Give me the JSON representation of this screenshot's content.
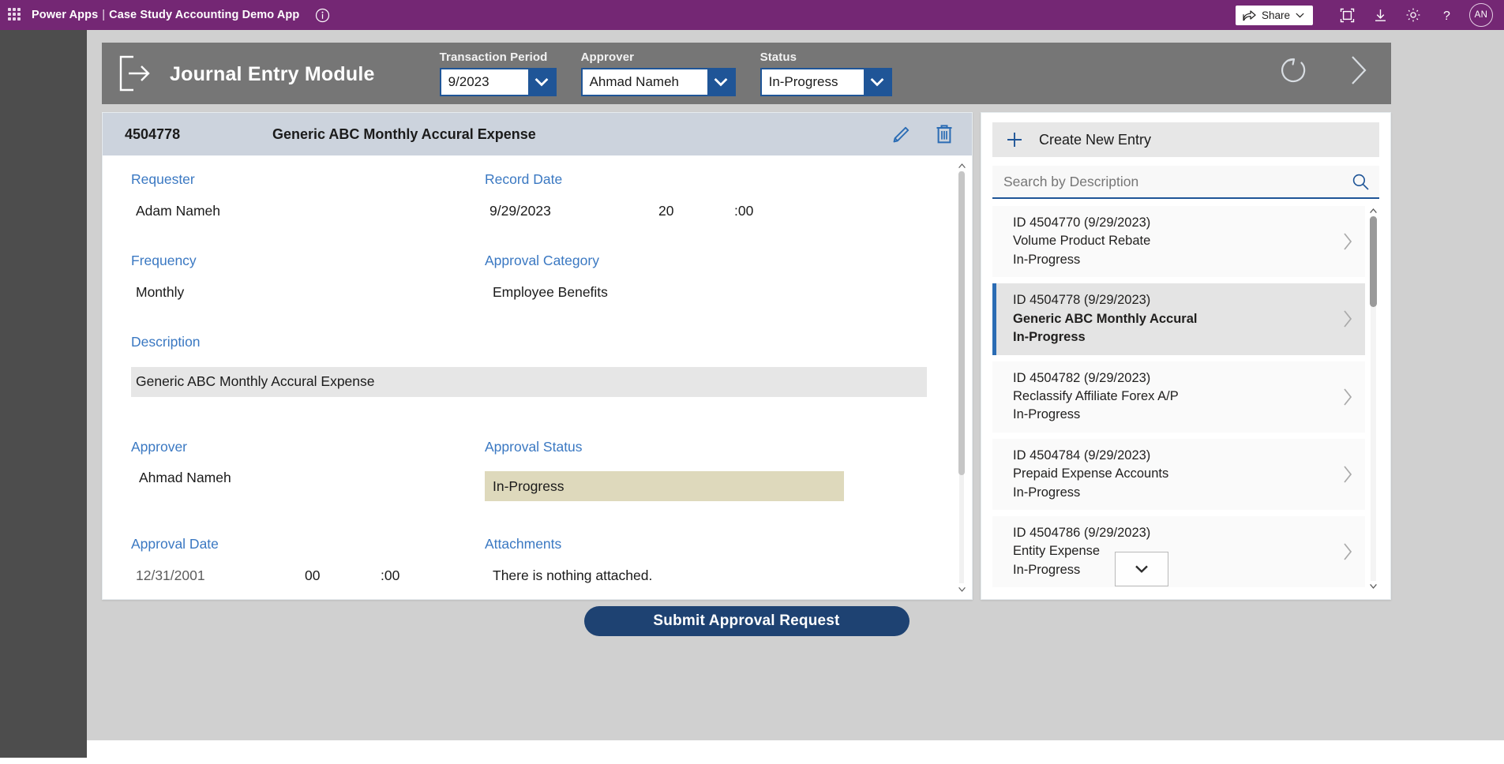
{
  "suite_bar": {
    "waffle_label": "app-launcher",
    "brand": "Power Apps",
    "separator": "|",
    "app_name": "Case Study Accounting Demo App",
    "share_label": "Share",
    "avatar_initials": "AN"
  },
  "module": {
    "title": "Journal Entry Module",
    "filters": [
      {
        "label": "Transaction Period",
        "value": "9/2023"
      },
      {
        "label": "Approver",
        "value": "Ahmad Nameh"
      },
      {
        "label": "Status",
        "value": "In-Progress"
      }
    ]
  },
  "record": {
    "id": "4504778",
    "title": "Generic ABC Monthly Accural Expense",
    "fields": {
      "requester_label": "Requester",
      "requester_value": "Adam Nameh",
      "record_date_label": "Record Date",
      "record_date_value": "9/29/2023",
      "record_date_hour": "20",
      "record_date_minute": ":00",
      "frequency_label": "Frequency",
      "frequency_value": "Monthly",
      "approval_category_label": "Approval Category",
      "approval_category_value": "Employee Benefits",
      "description_label": "Description",
      "description_value": "Generic ABC Monthly Accural Expense",
      "approver_label": "Approver",
      "approver_value": "Ahmad Nameh",
      "approval_status_label": "Approval Status",
      "approval_status_value": "In-Progress",
      "approval_date_label": "Approval Date",
      "approval_date_value": "12/31/2001",
      "approval_date_hour": "00",
      "approval_date_minute": ":00",
      "attachments_label": "Attachments",
      "attachments_value": "There is nothing attached."
    }
  },
  "side_panel": {
    "create_label": "Create New Entry",
    "search_placeholder": "Search by Description",
    "search_value": "",
    "items": [
      {
        "id_line": "ID 4504770 (9/29/2023)",
        "description": "Volume Product Rebate",
        "status": "In-Progress",
        "selected": false
      },
      {
        "id_line": "ID 4504778 (9/29/2023)",
        "description": "Generic ABC Monthly Accural",
        "status": "In-Progress",
        "selected": true
      },
      {
        "id_line": "ID 4504782 (9/29/2023)",
        "description": "Reclassify Affiliate Forex A/P",
        "status": "In-Progress",
        "selected": false
      },
      {
        "id_line": "ID 4504784 (9/29/2023)",
        "description": "Prepaid Expense Accounts",
        "status": "In-Progress",
        "selected": false
      },
      {
        "id_line": "ID 4504786 (9/29/2023)",
        "description": "Entity Expense",
        "status": "In-Progress",
        "selected": false
      }
    ]
  },
  "footer": {
    "submit_label": "Submit Approval Request"
  },
  "colors": {
    "suite_bar": "#742774",
    "module_header": "#767676",
    "accent_blue": "#1f5597",
    "label_blue": "#3a78c2",
    "status_highlight": "#ded9bc",
    "submit_button": "#1e4272",
    "selection_bar": "#2b6cb4"
  }
}
